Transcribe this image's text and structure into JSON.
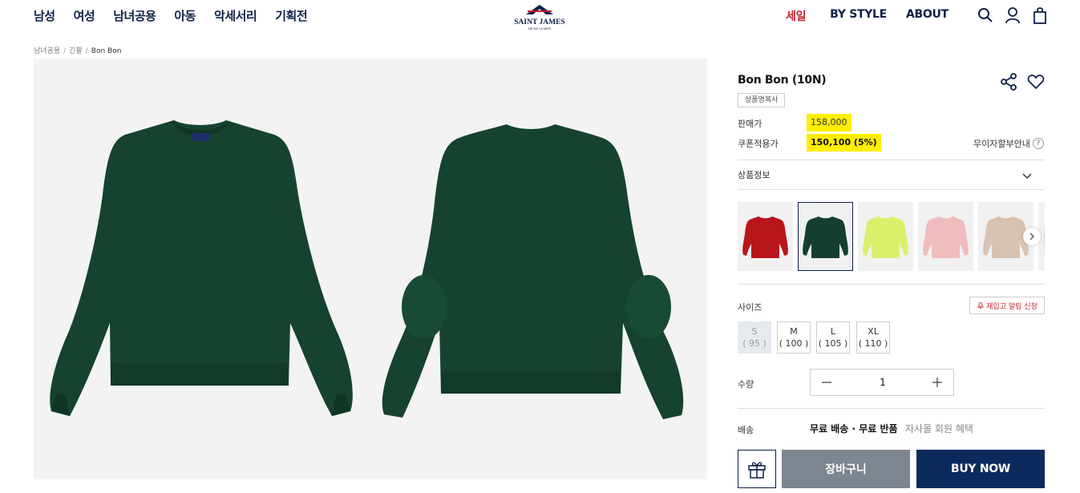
{
  "header": {
    "nav_left": [
      "남성",
      "여성",
      "남녀공용",
      "아동",
      "악세서리",
      "기획전"
    ],
    "logo_text": "SAINT JAMES",
    "logo_sub": "NÉ DE LA MER",
    "nav_right": [
      "세일",
      "BY STYLE",
      "ABOUT"
    ],
    "icons": [
      "search-icon",
      "user-icon",
      "shopping-bag-icon"
    ],
    "sale_color": "#c8202e",
    "nav_color": "#0f2147"
  },
  "breadcrumb": [
    "남녀공용",
    "긴팔",
    "Bon Bon"
  ],
  "product": {
    "title": "Bon Bon (10N)",
    "badge": "상품명복사",
    "price_label": "판매가",
    "price": "158,000",
    "coupon_label": "쿠폰적용가",
    "coupon_price": "150,100 (5%)",
    "installment": "무이자할부안내",
    "info_label": "상품정보",
    "colors": [
      {
        "name": "red",
        "hex": "#b8161b"
      },
      {
        "name": "green",
        "hex": "#143f2e",
        "selected": true
      },
      {
        "name": "lime",
        "hex": "#dbef6a"
      },
      {
        "name": "pink",
        "hex": "#efbdbd"
      },
      {
        "name": "beige",
        "hex": "#d8c2b2"
      },
      {
        "name": "partial",
        "hex": "#cfc6bb"
      }
    ],
    "size_label": "사이즈",
    "restock_label": "재입고 알림 신청",
    "sizes": [
      {
        "label": "S",
        "sub": "( 95 )",
        "disabled": true
      },
      {
        "label": "M",
        "sub": "( 100 )",
        "disabled": false
      },
      {
        "label": "L",
        "sub": "( 105 )",
        "disabled": false
      },
      {
        "label": "XL",
        "sub": "( 110 )",
        "disabled": false
      }
    ],
    "qty_label": "수량",
    "qty": "1",
    "ship_label": "배송",
    "ship_value": "무료 배송 · 무료 반품",
    "ship_sub": "자사몰 회원 혜택",
    "cart_label": "장바구니",
    "buy_label": "BUY NOW"
  }
}
